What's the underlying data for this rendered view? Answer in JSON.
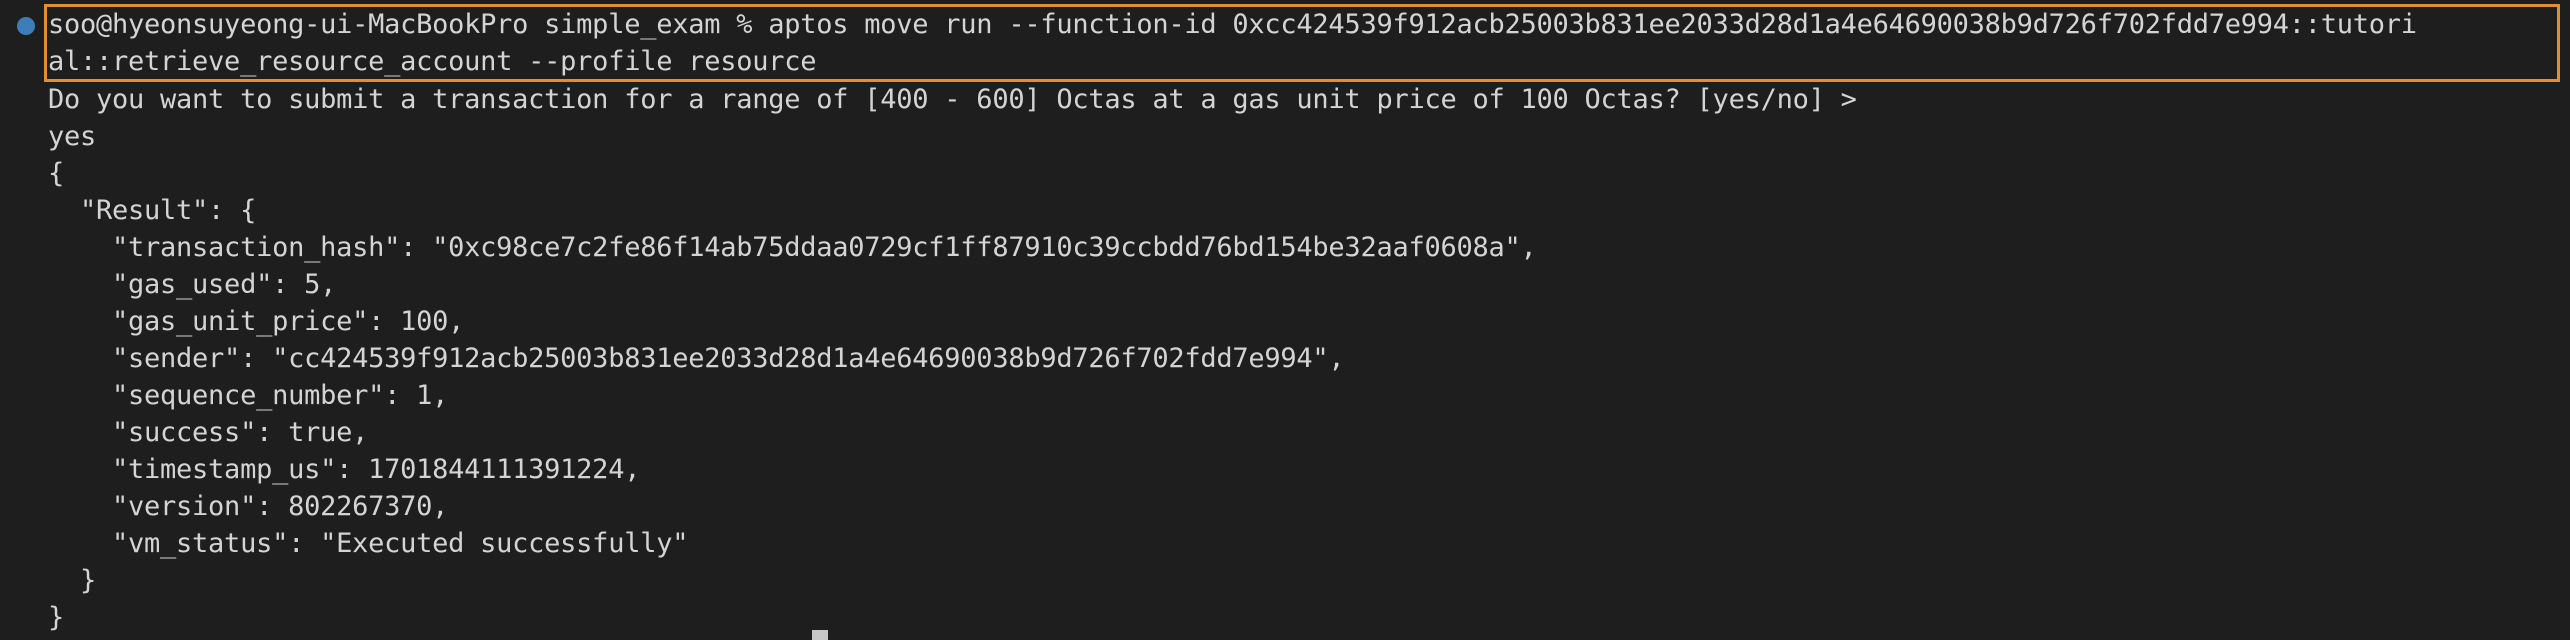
{
  "terminal": {
    "status_icon": "command-status-dot",
    "command_line_1": "soo@hyeonsuyeong-ui-MacBookPro simple_exam % aptos move run --function-id 0xcc424539f912acb25003b831ee2033d28d1a4e64690038b9d726f702fdd7e994::tutori",
    "command_line_2": "al::retrieve_resource_account --profile resource",
    "prompt_line": "Do you want to submit a transaction for a range of [400 - 600] Octas at a gas unit price of 100 Octas? [yes/no] >",
    "answer_line": "yes",
    "output": [
      "{",
      "  \"Result\": {",
      "    \"transaction_hash\": \"0xc98ce7c2fe86f14ab75ddaa0729cf1ff87910c39ccbdd76bd154be32aaf0608a\",",
      "    \"gas_used\": 5,",
      "    \"gas_unit_price\": 100,",
      "    \"sender\": \"cc424539f912acb25003b831ee2033d28d1a4e64690038b9d726f702fdd7e994\",",
      "    \"sequence_number\": 1,",
      "    \"success\": true,",
      "    \"timestamp_us\": 1701844111391224,",
      "    \"version\": 802267370,",
      "    \"vm_status\": \"Executed successfully\"",
      "  }",
      "}"
    ],
    "colors": {
      "background": "#1e1e1e",
      "text": "#d4d4d4",
      "highlight_border": "#e48f2f",
      "status_dot": "#3c7fb8"
    }
  }
}
